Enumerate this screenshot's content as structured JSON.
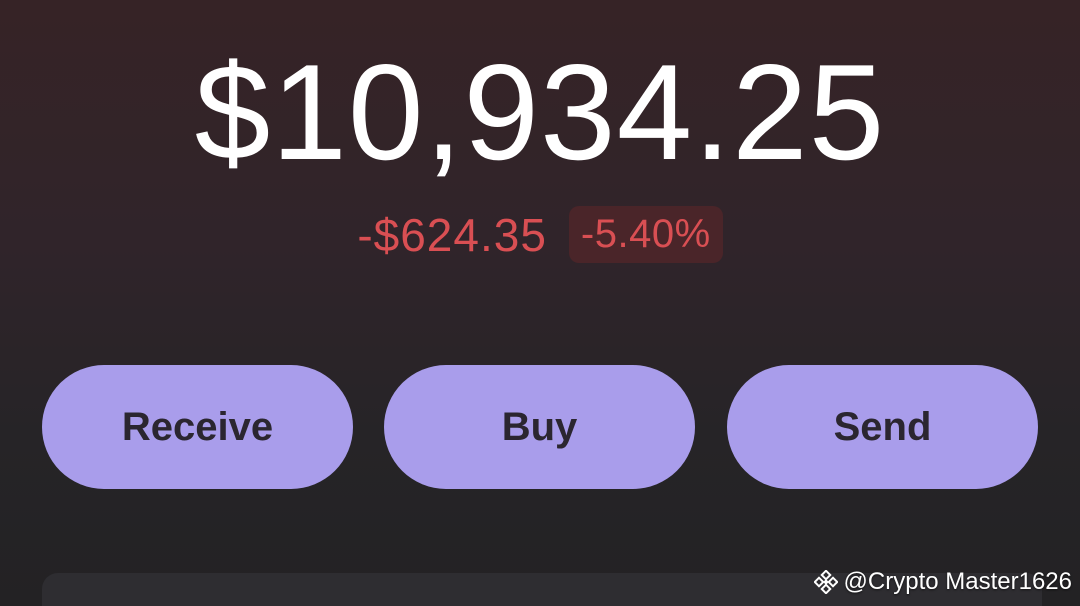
{
  "wallet": {
    "balance": "$10,934.25",
    "change_amount": "-$624.35",
    "change_percent": "-5.40%"
  },
  "actions": {
    "receive_label": "Receive",
    "buy_label": "Buy",
    "send_label": "Send"
  },
  "watermark": {
    "text": "@Crypto Master1626",
    "icon": "binance-logo-icon"
  },
  "colors": {
    "background_top": "#362326",
    "background_bottom": "#232224",
    "negative": "#d94f53",
    "button": "#a99deb",
    "button_text": "#2b2630"
  }
}
